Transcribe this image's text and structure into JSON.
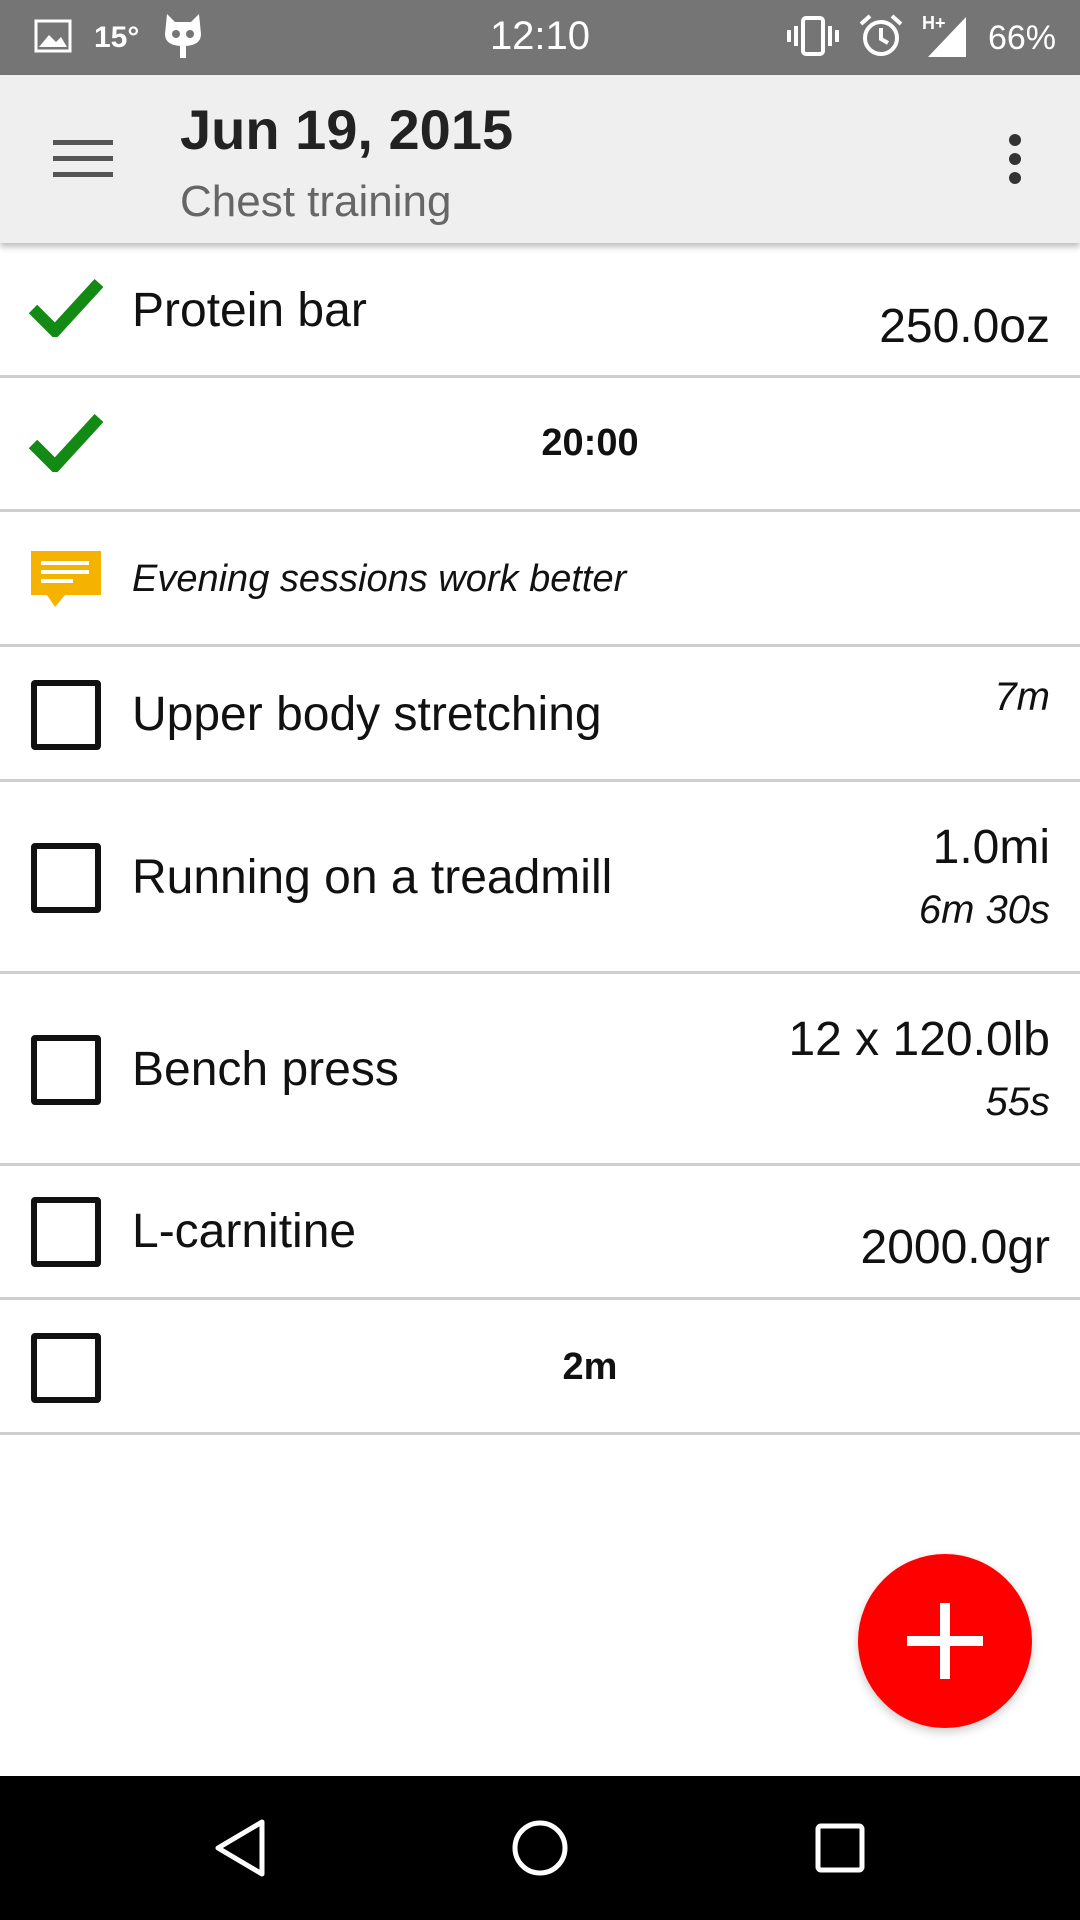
{
  "status_bar": {
    "temperature": "15°",
    "time": "12:10",
    "battery": "66%",
    "icons": [
      "image-icon",
      "cyanogen-mascot-icon",
      "vibrate-icon",
      "alarm-icon",
      "network-hplus-icon",
      "signal-icon"
    ]
  },
  "app_bar": {
    "title": "Jun 19, 2015",
    "subtitle": "Chest training",
    "menu_icon": "hamburger-menu-icon",
    "overflow_icon": "more-vert-icon"
  },
  "items": [
    {
      "type": "checked",
      "title": "Protein bar",
      "value": "250.0oz"
    },
    {
      "type": "checked",
      "center_label": "20:00"
    },
    {
      "type": "note",
      "text": "Evening sessions work better"
    },
    {
      "type": "unchecked",
      "title": "Upper body stretching",
      "value_sub": "7m"
    },
    {
      "type": "unchecked",
      "title": "Running on a treadmill",
      "value": "1.0mi",
      "value_sub": "6m 30s"
    },
    {
      "type": "unchecked",
      "title": "Bench press",
      "value": "12 x 120.0lb",
      "value_sub": "55s"
    },
    {
      "type": "unchecked",
      "title": "L-carnitine",
      "value": "2000.0gr"
    },
    {
      "type": "unchecked",
      "center_label": "2m"
    }
  ],
  "fab": {
    "icon": "plus-icon"
  },
  "colors": {
    "status_bar": "#757575",
    "app_bar": "#efefef",
    "check_green": "#138a13",
    "note_amber": "#f5b300",
    "fab_red": "#ff0000",
    "divider": "#cfcfcf"
  },
  "nav_bar": {
    "icons": [
      "back-icon",
      "home-icon",
      "recents-icon"
    ]
  }
}
